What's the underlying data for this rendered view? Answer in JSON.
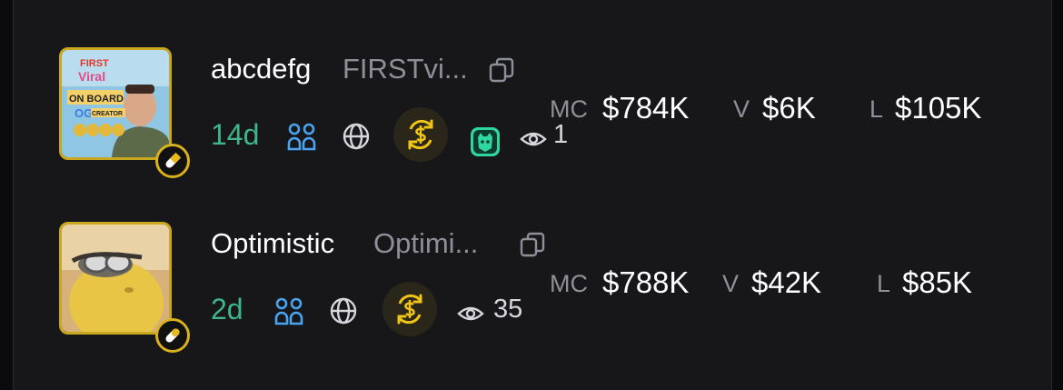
{
  "tokens": [
    {
      "name": "abcdefg",
      "symbol": "FIRSTvi...",
      "age": "14d",
      "viewers": "1",
      "avatar_art_text": [
        "FIRST",
        "Viral",
        "ON BOARD",
        "OG",
        "CREATOR"
      ],
      "icons": [
        "copy-icon",
        "holders-icon",
        "globe-icon",
        "dollar-coin-icon",
        "mascot-icon",
        "eye-icon",
        "pill-icon"
      ],
      "mc_label": "MC",
      "mc_value": "$784K",
      "v_label": "V",
      "v_value": "$6K",
      "l_label": "L",
      "l_value": "$105K"
    },
    {
      "name": "Optimistic",
      "symbol": "Optimi...",
      "age": "2d",
      "viewers": "35",
      "icons": [
        "copy-icon",
        "holders-icon",
        "globe-icon",
        "dollar-coin-icon",
        "eye-icon",
        "pill-icon"
      ],
      "mc_label": "MC",
      "mc_value": "$788K",
      "v_label": "V",
      "v_value": "$42K",
      "l_label": "L",
      "l_value": "$85K"
    }
  ],
  "colors": {
    "background": "#17171a",
    "age_green": "#3fb58a",
    "holders_blue": "#4aa3f0",
    "gold": "#d8b21c",
    "muted": "#8f8f99"
  }
}
